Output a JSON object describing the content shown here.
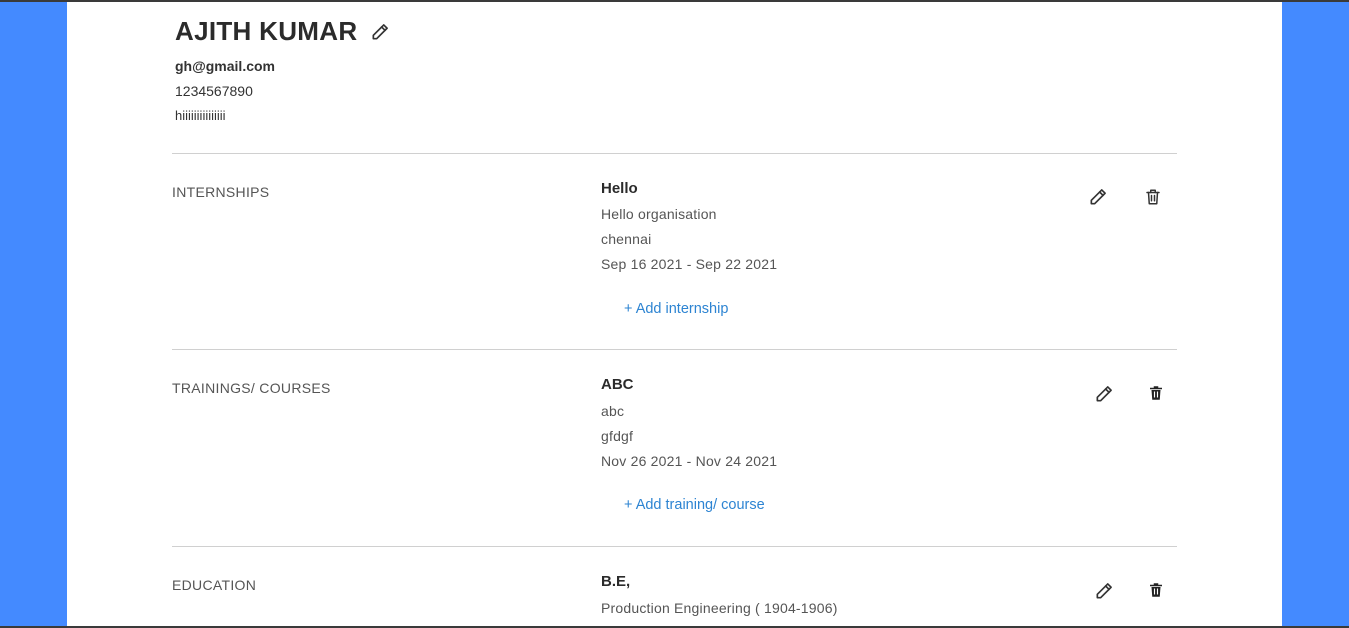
{
  "profile": {
    "name": "AJITH KUMAR",
    "email": "gh@gmail.com",
    "phone": "1234567890",
    "bio": "hiiiiiiiiiiiiiii"
  },
  "internships": {
    "title": "INTERNSHIPS",
    "entry": {
      "role": "Hello",
      "organisation": "Hello organisation",
      "location": "chennai",
      "dates": "Sep 16 2021 - Sep 22 2021"
    },
    "add_label": "+ Add internship"
  },
  "trainings": {
    "title": "TRAININGS/ COURSES",
    "entry": {
      "name": "ABC",
      "organisation": "abc",
      "location": "gfdgf",
      "dates": "Nov 26 2021 - Nov 24 2021"
    },
    "add_label": "+ Add training/ course"
  },
  "education": {
    "title": "EDUCATION",
    "entry": {
      "degree": "B.E,",
      "stream": "Production Engineering ( 1904-1906)"
    }
  },
  "icons": {
    "edit": "pencil-icon",
    "delete": "trash-icon"
  },
  "colors": {
    "background": "#448aff",
    "link": "#2d84d2"
  }
}
